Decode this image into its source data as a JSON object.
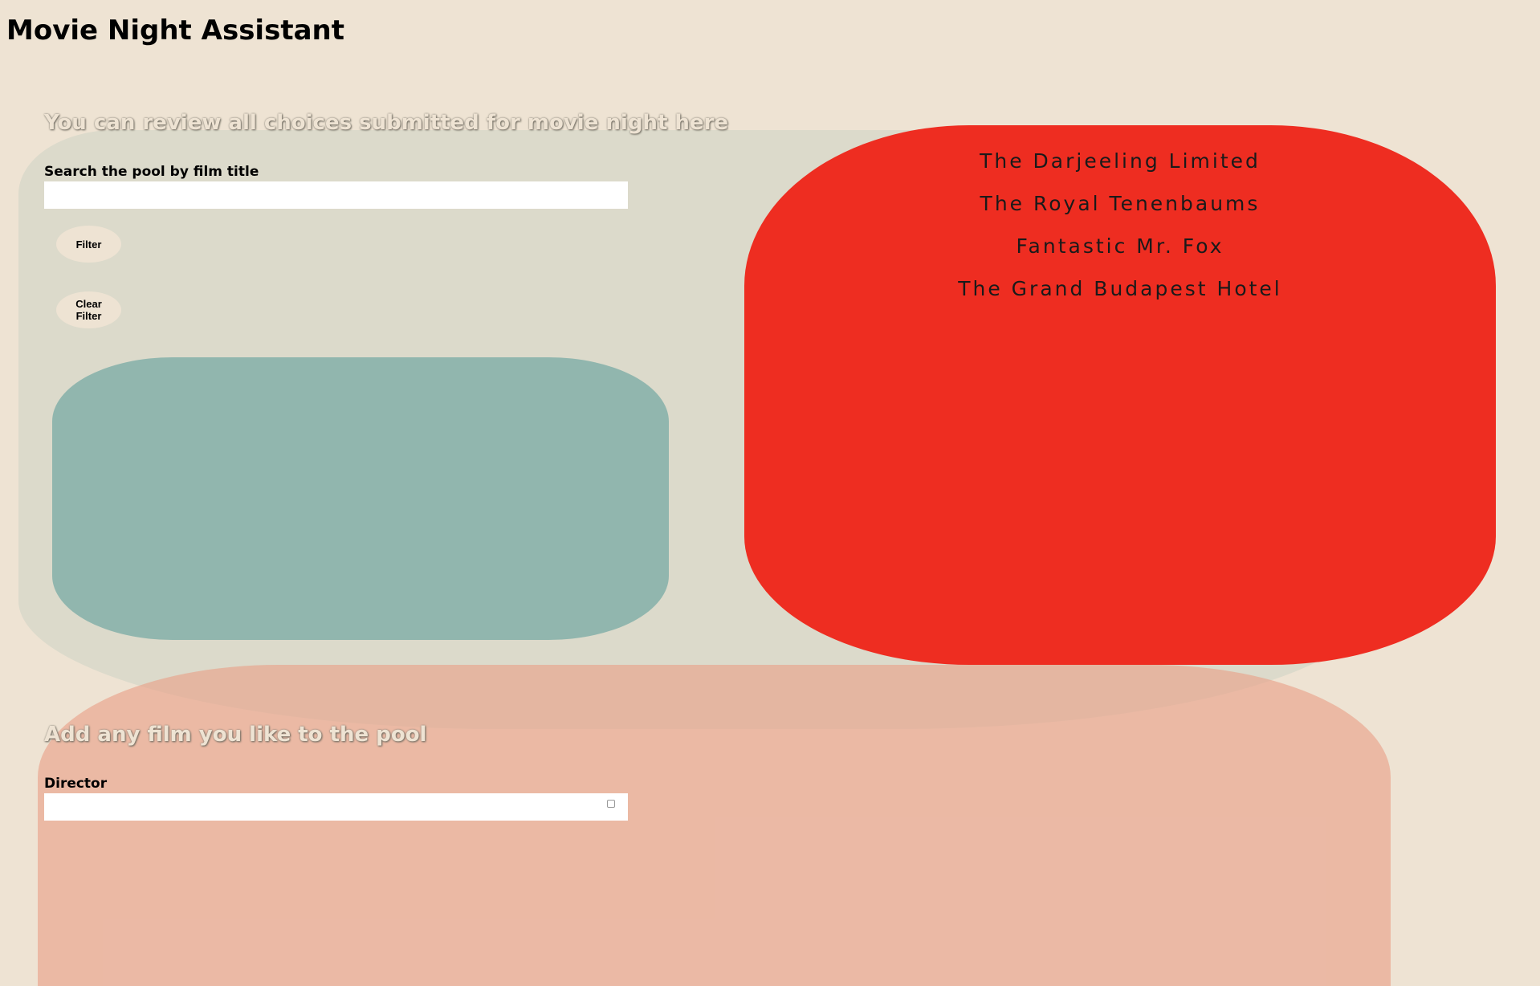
{
  "app": {
    "title": "Movie Night Assistant"
  },
  "review": {
    "heading": "You can review all choices submitted for movie night here",
    "search_label": "Search the pool by film title",
    "search_value": "",
    "search_placeholder": "",
    "filter_label": "Filter",
    "clear_filter_label": "Clear Filter"
  },
  "pool": {
    "films": [
      "The Darjeeling Limited",
      "The Royal Tenenbaums",
      "Fantastic Mr. Fox",
      "The Grand Budapest Hotel"
    ]
  },
  "add": {
    "heading": "Add any film you like to the pool",
    "director_label": "Director",
    "director_value": ""
  },
  "colors": {
    "background": "#eee3d3",
    "review_section": "#dcdacb",
    "results_panel": "#91b6ae",
    "pool_panel": "#ee2d21",
    "add_section": "#e9a088"
  }
}
